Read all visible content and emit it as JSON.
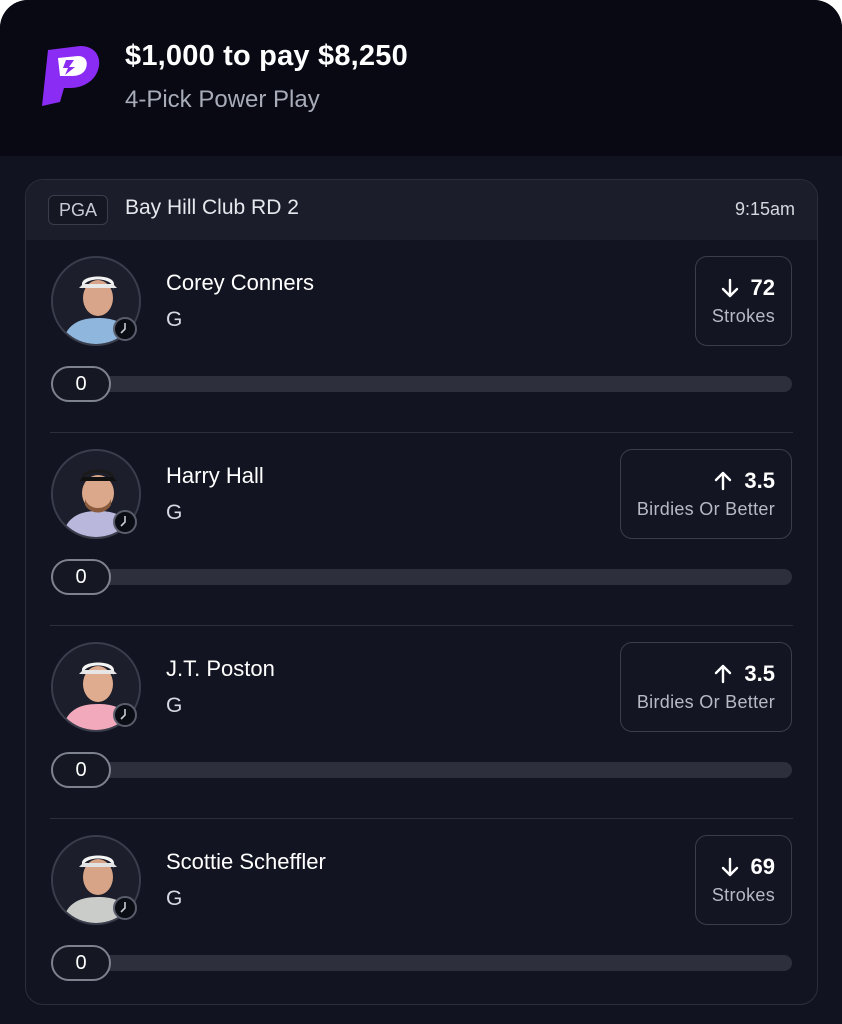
{
  "entry": {
    "title": "$1,000 to pay $8,250",
    "subtitle": "4-Pick Power Play"
  },
  "brand": {
    "logo_icon": "prizepicks-logo-icon",
    "accent": "#8b2cf5"
  },
  "event": {
    "league": "PGA",
    "name": "Bay Hill Club RD 2",
    "time": "9:15am"
  },
  "picks": [
    {
      "name": "Corey Conners",
      "position": "G",
      "direction": "down",
      "direction_icon": "arrow-down-icon",
      "line": "72",
      "stat": "Strokes",
      "progress": "0",
      "shirt": "#8fb7dd"
    },
    {
      "name": "Harry Hall",
      "position": "G",
      "direction": "up",
      "direction_icon": "arrow-up-icon",
      "line": "3.5",
      "stat": "Birdies Or Better",
      "progress": "0",
      "shirt": "#b9b7dc"
    },
    {
      "name": "J.T. Poston",
      "position": "G",
      "direction": "up",
      "direction_icon": "arrow-up-icon",
      "line": "3.5",
      "stat": "Birdies Or Better",
      "progress": "0",
      "shirt": "#f2a9bb"
    },
    {
      "name": "Scottie Scheffler",
      "position": "G",
      "direction": "down",
      "direction_icon": "arrow-down-icon",
      "line": "69",
      "stat": "Strokes",
      "progress": "0",
      "shirt": "#c9ccc9"
    }
  ]
}
